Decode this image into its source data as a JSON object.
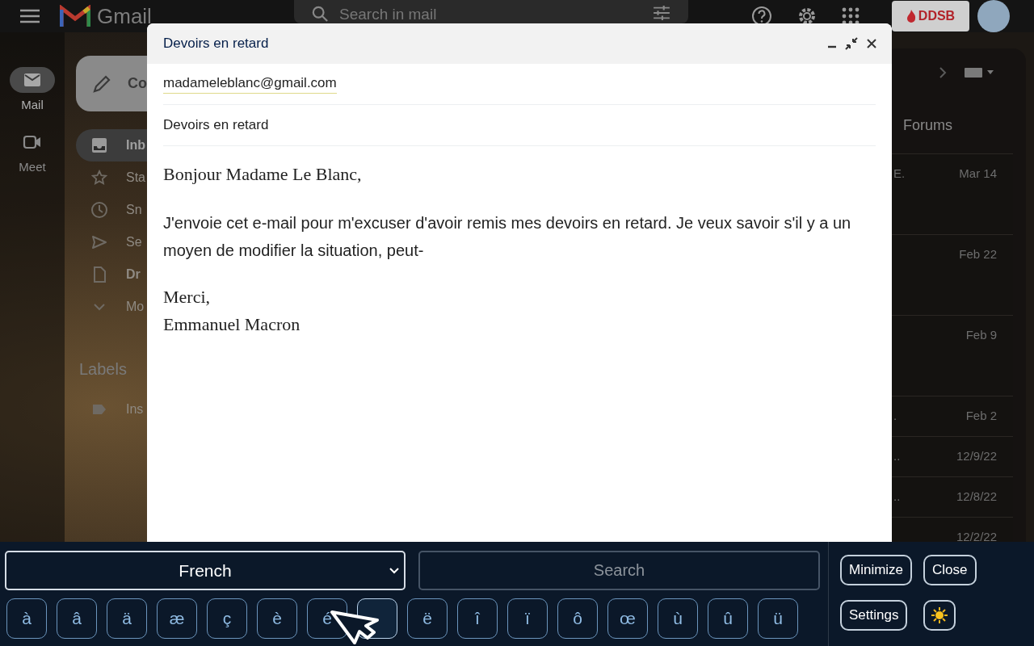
{
  "gmail": {
    "app_name": "Gmail",
    "search": {
      "placeholder": "Search in mail"
    },
    "org_badge": "DDSB",
    "rail": [
      {
        "label": "Mail",
        "kind": "mail",
        "selected": true
      },
      {
        "label": "Meet",
        "kind": "video",
        "selected": false
      }
    ],
    "compose_button": "Co",
    "folders": [
      {
        "label": "Inb",
        "kind": "inbox",
        "selected": true,
        "bold": true
      },
      {
        "label": "Sta",
        "kind": "star",
        "selected": false,
        "bold": false
      },
      {
        "label": "Sn",
        "kind": "clock",
        "selected": false,
        "bold": false
      },
      {
        "label": "Se",
        "kind": "send",
        "selected": false,
        "bold": false
      },
      {
        "label": "Dr",
        "kind": "file",
        "selected": false,
        "bold": true
      },
      {
        "label": "Mo",
        "kind": "chevron",
        "selected": false,
        "bold": false
      }
    ],
    "labels_heading": "Labels",
    "labels": [
      {
        "label": "Ins"
      }
    ],
    "tab": "Forums",
    "rows": [
      {
        "snippet": "E.",
        "date": "Mar 14",
        "kind": "tall"
      },
      {
        "date": "Feb 22",
        "kind": "tall"
      },
      {
        "date": "Feb 9",
        "kind": "tall"
      },
      {
        "snippet": ".",
        "date": "Feb 2",
        "kind": "short"
      },
      {
        "snippet": "..",
        "date": "12/9/22",
        "kind": "short"
      },
      {
        "snippet": "..",
        "date": "12/8/22",
        "kind": "short"
      },
      {
        "date": "12/2/22",
        "kind": "short"
      }
    ]
  },
  "compose": {
    "title": "Devoirs en retard",
    "to": "madameleblanc@gmail.com",
    "subject": "Devoirs en retard",
    "greeting": "Bonjour Madame Le Blanc,",
    "paragraph": "J'envoie cet e-mail pour m'excuser d'avoir remis mes devoirs en retard. Je veux savoir s'il y a un moyen de modifier la situation, peut-",
    "closing": "Merci,",
    "signature": "Emmanuel Macron"
  },
  "keyboard": {
    "language": "French",
    "search": {
      "placeholder": "Search"
    },
    "keys": [
      {
        "char": "à",
        "selected": false
      },
      {
        "char": "â",
        "selected": false
      },
      {
        "char": "ä",
        "selected": false
      },
      {
        "char": "æ",
        "selected": false
      },
      {
        "char": "ç",
        "selected": false
      },
      {
        "char": "è",
        "selected": false
      },
      {
        "char": "é",
        "selected": false
      },
      {
        "selected": true
      },
      {
        "char": "ë",
        "selected": false
      },
      {
        "char": "î",
        "selected": false
      },
      {
        "char": "ï",
        "selected": false
      },
      {
        "char": "ô",
        "selected": false
      },
      {
        "char": "œ",
        "selected": false
      },
      {
        "char": "ù",
        "selected": false
      },
      {
        "char": "û",
        "selected": false
      },
      {
        "char": "ü",
        "selected": false
      }
    ],
    "buttons": [
      {
        "label": "Minimize",
        "kind": "text"
      },
      {
        "label": "Close",
        "kind": "text"
      },
      {
        "label": "Settings",
        "kind": "text"
      },
      {
        "kind": "sun"
      }
    ]
  }
}
